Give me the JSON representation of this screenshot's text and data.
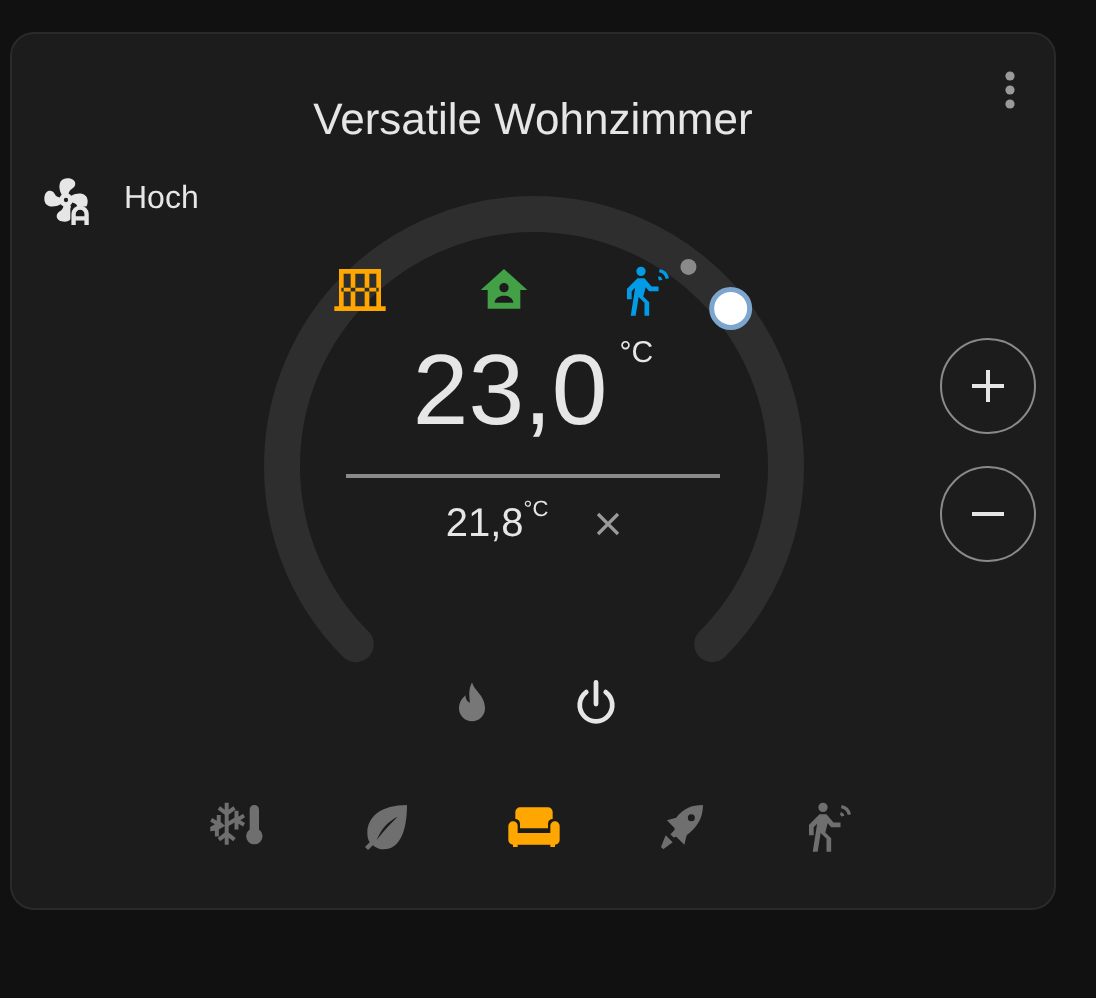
{
  "title": "Versatile Wohnzimmer",
  "fan": {
    "label": "Hoch"
  },
  "status_icons": [
    {
      "kind": "window",
      "color": "#ffa600"
    },
    {
      "kind": "presence",
      "color": "#43a047"
    },
    {
      "kind": "motion",
      "color": "#039be5"
    }
  ],
  "target": {
    "value": "23,0",
    "unit": "°C"
  },
  "current": {
    "value": "21,8",
    "unit": "°C"
  },
  "hvac_modes": [
    {
      "kind": "heat",
      "selected": false
    },
    {
      "kind": "off",
      "selected": true
    }
  ],
  "presets": [
    {
      "kind": "frost",
      "selected": false
    },
    {
      "kind": "eco",
      "selected": false
    },
    {
      "kind": "comfort",
      "selected": true
    },
    {
      "kind": "boost",
      "selected": false
    },
    {
      "kind": "motion",
      "selected": false
    }
  ]
}
